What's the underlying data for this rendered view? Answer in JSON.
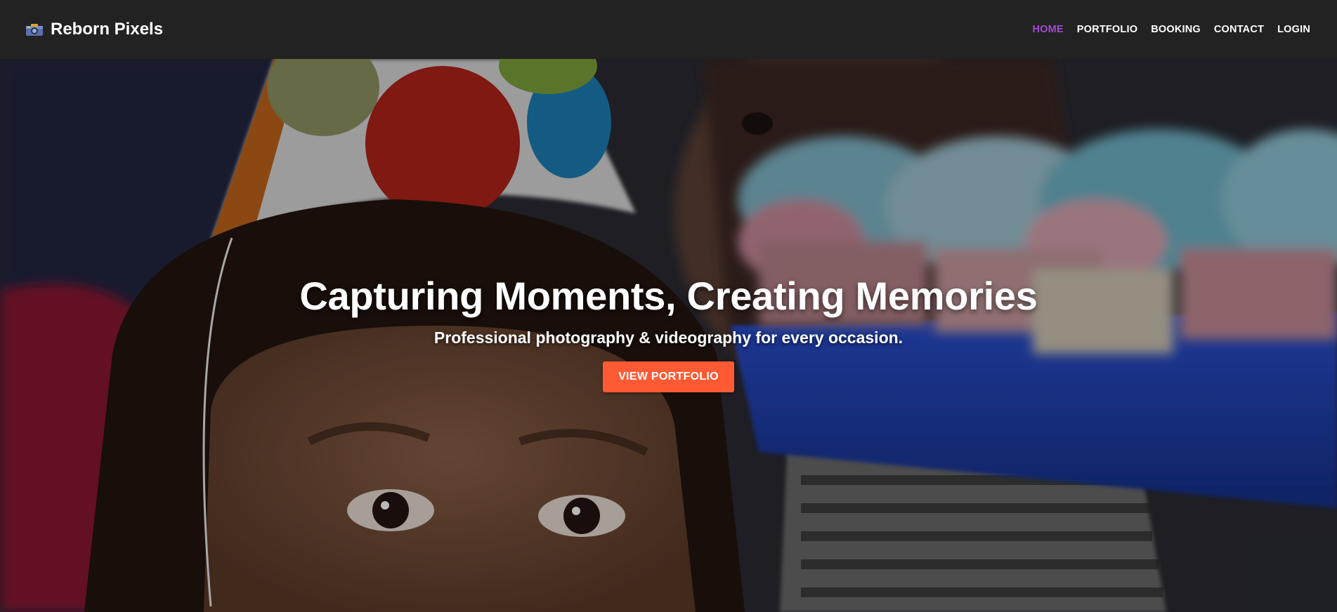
{
  "navbar": {
    "brand_icon": "camera-icon",
    "brand_label": "Reborn Pixels",
    "links": [
      {
        "label": "HOME",
        "active": true
      },
      {
        "label": "PORTFOLIO",
        "active": false
      },
      {
        "label": "BOOKING",
        "active": false
      },
      {
        "label": "CONTACT",
        "active": false
      },
      {
        "label": "LOGIN",
        "active": false
      }
    ]
  },
  "hero": {
    "title": "Capturing Moments, Creating Memories",
    "subtitle": "Professional photography & videography for every occasion.",
    "cta_label": "VIEW PORTFOLIO",
    "background_image": "child-with-party-hat-and-cupcakes"
  },
  "colors": {
    "navbar_bg": "#222222",
    "active_link": "#a24bd1",
    "cta_bg": "#ff5a34",
    "text": "#ffffff"
  }
}
